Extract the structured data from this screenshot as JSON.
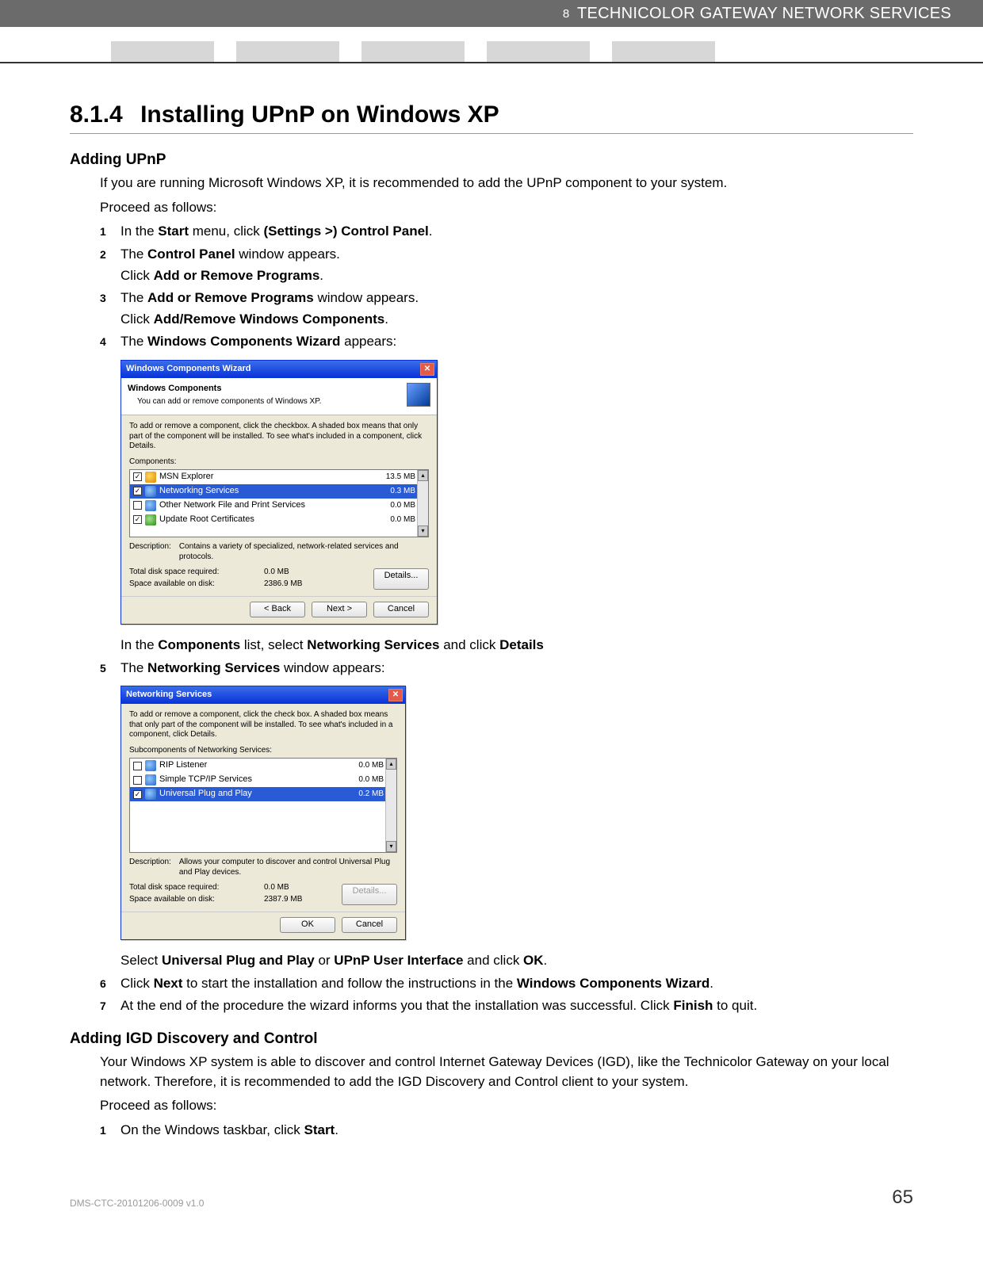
{
  "header": {
    "chapter_number": "8",
    "chapter_title": "TECHNICOLOR GATEWAY NETWORK SERVICES"
  },
  "title": {
    "number": "8.1.4",
    "text": "Installing UPnP on Windows XP"
  },
  "adding_upnp": {
    "heading": "Adding UPnP",
    "intro": "If you are running Microsoft Windows XP, it is recommended to add the UPnP component to your system.",
    "proceed": "Proceed as follows:",
    "s1_pre": "In the ",
    "s1_b1": "Start",
    "s1_mid": " menu, click ",
    "s1_b2": "(Settings >) Control Panel",
    "s1_post": ".",
    "s2_pre": "The ",
    "s2_b1": "Control Panel",
    "s2_post": " window appears.",
    "s2_sub_pre": "Click ",
    "s2_sub_b": "Add or Remove Programs",
    "s2_sub_post": ".",
    "s3_pre": "The ",
    "s3_b1": "Add or Remove Programs",
    "s3_post": " window appears.",
    "s3_sub_pre": "Click ",
    "s3_sub_b": "Add/Remove Windows Components",
    "s3_sub_post": ".",
    "s4_pre": "The ",
    "s4_b1": "Windows Components Wizard",
    "s4_post": " appears:",
    "s4_after_pre": "In the ",
    "s4_after_b1": "Components",
    "s4_after_mid1": " list, select ",
    "s4_after_b2": "Networking Services",
    "s4_after_mid2": " and click ",
    "s4_after_b3": "Details",
    "s5_pre": "The ",
    "s5_b1": "Networking Services",
    "s5_post": " window appears:",
    "s5_after_pre": "Select ",
    "s5_after_b1": "Universal Plug and Play",
    "s5_after_mid1": " or ",
    "s5_after_b2": "UPnP User Interface",
    "s5_after_mid2": " and click ",
    "s5_after_b3": "OK",
    "s5_after_post": ".",
    "s6_pre": "Click ",
    "s6_b1": "Next",
    "s6_mid": " to start the installation and follow the instructions in the ",
    "s6_b2": "Windows Components Wizard",
    "s6_post": ".",
    "s7_pre": "At the end of the procedure the wizard informs you that the installation was successful. Click ",
    "s7_b1": "Finish",
    "s7_post": " to quit."
  },
  "wizard1": {
    "title": "Windows Components Wizard",
    "head_bold": "Windows Components",
    "head_sub": "You can add or remove components of Windows XP.",
    "hint": "To add or remove a component, click the checkbox. A shaded box means that only part of the component will be installed. To see what's included in a component, click Details.",
    "components_label": "Components:",
    "rows": [
      {
        "checked": true,
        "name": "MSN Explorer",
        "size": "13.5 MB"
      },
      {
        "checked": true,
        "name": "Networking Services",
        "size": "0.3 MB",
        "selected": true
      },
      {
        "checked": false,
        "name": "Other Network File and Print Services",
        "size": "0.0 MB"
      },
      {
        "checked": true,
        "name": "Update Root Certificates",
        "size": "0.0 MB"
      }
    ],
    "description_label": "Description:",
    "description": "Contains a variety of specialized, network-related services and protocols.",
    "disk_required_label": "Total disk space required:",
    "disk_required": "0.0 MB",
    "disk_available_label": "Space available on disk:",
    "disk_available": "2386.9 MB",
    "details_btn": "Details...",
    "back_btn": "< Back",
    "next_btn": "Next >",
    "cancel_btn": "Cancel"
  },
  "wizard2": {
    "title": "Networking Services",
    "hint": "To add or remove a component, click the check box. A shaded box means that only part of the component will be installed. To see what's included in a component, click Details.",
    "sub_label": "Subcomponents of Networking Services:",
    "rows": [
      {
        "checked": false,
        "name": "RIP Listener",
        "size": "0.0 MB"
      },
      {
        "checked": false,
        "name": "Simple TCP/IP Services",
        "size": "0.0 MB"
      },
      {
        "checked": true,
        "name": "Universal Plug and Play",
        "size": "0.2 MB",
        "selected": true
      }
    ],
    "description_label": "Description:",
    "description": "Allows your computer to discover and control Universal Plug and Play devices.",
    "disk_required_label": "Total disk space required:",
    "disk_required": "0.0 MB",
    "disk_available_label": "Space available on disk:",
    "disk_available": "2387.9 MB",
    "details_btn": "Details...",
    "ok_btn": "OK",
    "cancel_btn": "Cancel"
  },
  "adding_igd": {
    "heading": "Adding IGD Discovery and Control",
    "intro": "Your Windows XP system is able to discover and control Internet Gateway Devices (IGD), like the Technicolor Gateway on your local network. Therefore, it is recommended to add the IGD Discovery and Control client to your system.",
    "proceed": "Proceed as follows:",
    "s1_pre": "On the Windows taskbar, click ",
    "s1_b1": "Start",
    "s1_post": "."
  },
  "footer": {
    "docid": "DMS-CTC-20101206-0009 v1.0",
    "pageno": "65"
  }
}
